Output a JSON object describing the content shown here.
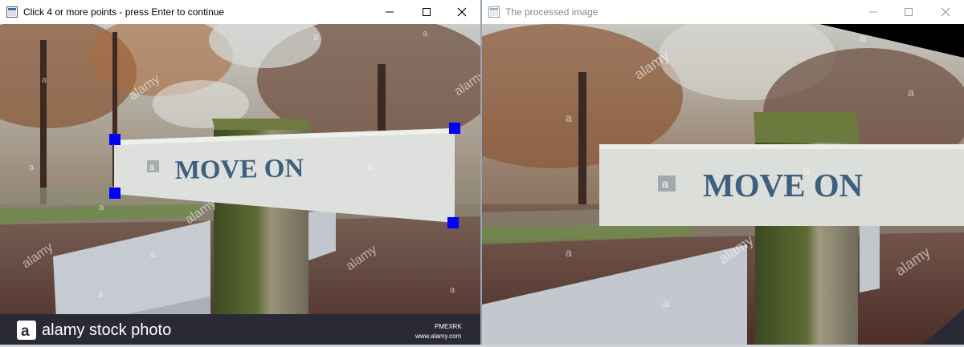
{
  "window_left": {
    "title": "Click 4 or more points - press Enter to continue",
    "icon": "window-app-icon",
    "controls": {
      "minimize": "minimize-icon",
      "maximize": "maximize-icon",
      "close": "close-icon"
    }
  },
  "window_right": {
    "title": "The processed image",
    "icon": "window-app-icon",
    "controls": {
      "minimize": "minimize-icon",
      "maximize": "maximize-icon",
      "close": "close-icon"
    }
  },
  "image": {
    "sign_text": "MOVE ON",
    "watermark": "alamy",
    "watermark_letter": "a",
    "banner_text": "alamy stock photo",
    "banner_code": "PMEXRK",
    "banner_url": "www.alamy.com",
    "point_marker_color": "#0000ff",
    "point_marker_count": 4
  }
}
